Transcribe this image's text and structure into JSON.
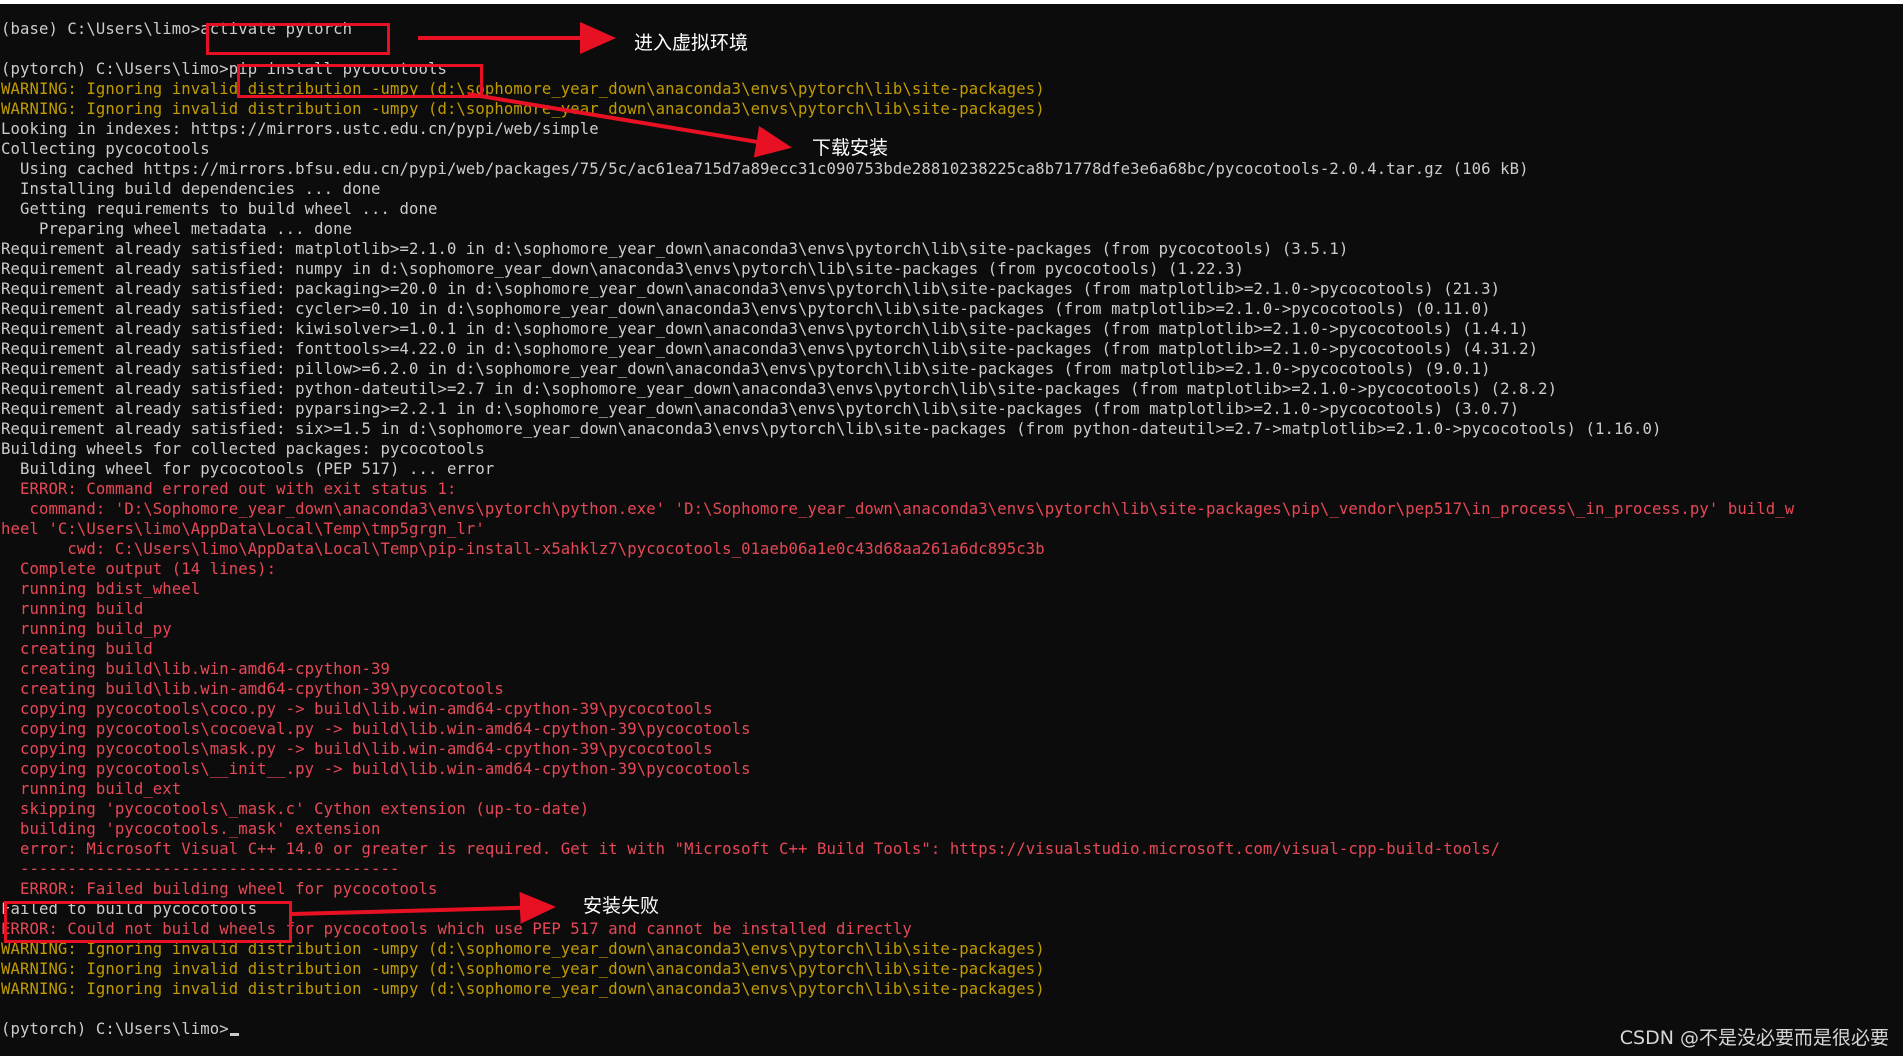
{
  "terminal": {
    "lines": [
      {
        "text": "(base) C:\\Users\\limo>activate pytorch",
        "style": "normal"
      },
      {
        "text": "",
        "style": "normal"
      },
      {
        "text": "(pytorch) C:\\Users\\limo>pip install pycocotools",
        "style": "normal"
      },
      {
        "text": "WARNING: Ignoring invalid distribution -umpy (d:\\sophomore_year_down\\anaconda3\\envs\\pytorch\\lib\\site-packages)",
        "style": "warn"
      },
      {
        "text": "WARNING: Ignoring invalid distribution -umpy (d:\\sophomore_year_down\\anaconda3\\envs\\pytorch\\lib\\site-packages)",
        "style": "warn"
      },
      {
        "text": "Looking in indexes: https://mirrors.ustc.edu.cn/pypi/web/simple",
        "style": "normal"
      },
      {
        "text": "Collecting pycocotools",
        "style": "normal"
      },
      {
        "text": "  Using cached https://mirrors.bfsu.edu.cn/pypi/web/packages/75/5c/ac61ea715d7a89ecc31c090753bde28810238225ca8b71778dfe3e6a68bc/pycocotools-2.0.4.tar.gz (106 kB)",
        "style": "normal"
      },
      {
        "text": "  Installing build dependencies ... done",
        "style": "normal"
      },
      {
        "text": "  Getting requirements to build wheel ... done",
        "style": "normal"
      },
      {
        "text": "    Preparing wheel metadata ... done",
        "style": "normal"
      },
      {
        "text": "Requirement already satisfied: matplotlib>=2.1.0 in d:\\sophomore_year_down\\anaconda3\\envs\\pytorch\\lib\\site-packages (from pycocotools) (3.5.1)",
        "style": "normal"
      },
      {
        "text": "Requirement already satisfied: numpy in d:\\sophomore_year_down\\anaconda3\\envs\\pytorch\\lib\\site-packages (from pycocotools) (1.22.3)",
        "style": "normal"
      },
      {
        "text": "Requirement already satisfied: packaging>=20.0 in d:\\sophomore_year_down\\anaconda3\\envs\\pytorch\\lib\\site-packages (from matplotlib>=2.1.0->pycocotools) (21.3)",
        "style": "normal"
      },
      {
        "text": "Requirement already satisfied: cycler>=0.10 in d:\\sophomore_year_down\\anaconda3\\envs\\pytorch\\lib\\site-packages (from matplotlib>=2.1.0->pycocotools) (0.11.0)",
        "style": "normal"
      },
      {
        "text": "Requirement already satisfied: kiwisolver>=1.0.1 in d:\\sophomore_year_down\\anaconda3\\envs\\pytorch\\lib\\site-packages (from matplotlib>=2.1.0->pycocotools) (1.4.1)",
        "style": "normal"
      },
      {
        "text": "Requirement already satisfied: fonttools>=4.22.0 in d:\\sophomore_year_down\\anaconda3\\envs\\pytorch\\lib\\site-packages (from matplotlib>=2.1.0->pycocotools) (4.31.2)",
        "style": "normal"
      },
      {
        "text": "Requirement already satisfied: pillow>=6.2.0 in d:\\sophomore_year_down\\anaconda3\\envs\\pytorch\\lib\\site-packages (from matplotlib>=2.1.0->pycocotools) (9.0.1)",
        "style": "normal"
      },
      {
        "text": "Requirement already satisfied: python-dateutil>=2.7 in d:\\sophomore_year_down\\anaconda3\\envs\\pytorch\\lib\\site-packages (from matplotlib>=2.1.0->pycocotools) (2.8.2)",
        "style": "normal"
      },
      {
        "text": "Requirement already satisfied: pyparsing>=2.2.1 in d:\\sophomore_year_down\\anaconda3\\envs\\pytorch\\lib\\site-packages (from matplotlib>=2.1.0->pycocotools) (3.0.7)",
        "style": "normal"
      },
      {
        "text": "Requirement already satisfied: six>=1.5 in d:\\sophomore_year_down\\anaconda3\\envs\\pytorch\\lib\\site-packages (from python-dateutil>=2.7->matplotlib>=2.1.0->pycocotools) (1.16.0)",
        "style": "normal"
      },
      {
        "text": "Building wheels for collected packages: pycocotools",
        "style": "normal"
      },
      {
        "text": "  Building wheel for pycocotools (PEP 517) ... error",
        "style": "normal"
      },
      {
        "text": "  ERROR: Command errored out with exit status 1:",
        "style": "err"
      },
      {
        "text": "   command: 'D:\\Sophomore_year_down\\anaconda3\\envs\\pytorch\\python.exe' 'D:\\Sophomore_year_down\\anaconda3\\envs\\pytorch\\lib\\site-packages\\pip\\_vendor\\pep517\\in_process\\_in_process.py' build_w",
        "style": "err"
      },
      {
        "text": "heel 'C:\\Users\\limo\\AppData\\Local\\Temp\\tmp5grgn_lr'",
        "style": "err"
      },
      {
        "text": "       cwd: C:\\Users\\limo\\AppData\\Local\\Temp\\pip-install-x5ahklz7\\pycocotools_01aeb06a1e0c43d68aa261a6dc895c3b",
        "style": "err"
      },
      {
        "text": "  Complete output (14 lines):",
        "style": "err"
      },
      {
        "text": "  running bdist_wheel",
        "style": "err"
      },
      {
        "text": "  running build",
        "style": "err"
      },
      {
        "text": "  running build_py",
        "style": "err"
      },
      {
        "text": "  creating build",
        "style": "err"
      },
      {
        "text": "  creating build\\lib.win-amd64-cpython-39",
        "style": "err"
      },
      {
        "text": "  creating build\\lib.win-amd64-cpython-39\\pycocotools",
        "style": "err"
      },
      {
        "text": "  copying pycocotools\\coco.py -> build\\lib.win-amd64-cpython-39\\pycocotools",
        "style": "err"
      },
      {
        "text": "  copying pycocotools\\cocoeval.py -> build\\lib.win-amd64-cpython-39\\pycocotools",
        "style": "err"
      },
      {
        "text": "  copying pycocotools\\mask.py -> build\\lib.win-amd64-cpython-39\\pycocotools",
        "style": "err"
      },
      {
        "text": "  copying pycocotools\\__init__.py -> build\\lib.win-amd64-cpython-39\\pycocotools",
        "style": "err"
      },
      {
        "text": "  running build_ext",
        "style": "err"
      },
      {
        "text": "  skipping 'pycocotools\\_mask.c' Cython extension (up-to-date)",
        "style": "err"
      },
      {
        "text": "  building 'pycocotools._mask' extension",
        "style": "err"
      },
      {
        "text": "  error: Microsoft Visual C++ 14.0 or greater is required. Get it with \"Microsoft C++ Build Tools\": https://visualstudio.microsoft.com/visual-cpp-build-tools/",
        "style": "err"
      },
      {
        "text": "  ----------------------------------------",
        "style": "err"
      },
      {
        "text": "  ERROR: Failed building wheel for pycocotools",
        "style": "err"
      },
      {
        "text": "Failed to build pycocotools",
        "style": "normal"
      },
      {
        "text": "ERROR: Could not build wheels for pycocotools which use PEP 517 and cannot be installed directly",
        "style": "err"
      },
      {
        "text": "WARNING: Ignoring invalid distribution -umpy (d:\\sophomore_year_down\\anaconda3\\envs\\pytorch\\lib\\site-packages)",
        "style": "warn"
      },
      {
        "text": "WARNING: Ignoring invalid distribution -umpy (d:\\sophomore_year_down\\anaconda3\\envs\\pytorch\\lib\\site-packages)",
        "style": "warn"
      },
      {
        "text": "WARNING: Ignoring invalid distribution -umpy (d:\\sophomore_year_down\\anaconda3\\envs\\pytorch\\lib\\site-packages)",
        "style": "warn"
      },
      {
        "text": "",
        "style": "normal"
      },
      {
        "text": "(pytorch) C:\\Users\\limo>",
        "style": "normal"
      }
    ]
  },
  "annotations": {
    "enter_env": "进入虚拟环境",
    "download_install": "下载安装",
    "install_failed": "安装失败",
    "color": "#e81123"
  },
  "watermark": "CSDN @不是没必要而是很必要",
  "colors": {
    "background": "#0c0c0c",
    "text": "#cccccc",
    "warning": "#c19c00",
    "error": "#e74856"
  }
}
